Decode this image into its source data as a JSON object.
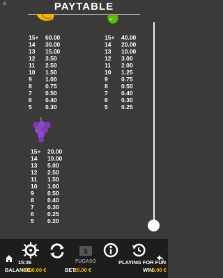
{
  "header": {
    "title": "PAYTABLE",
    "top_marker": "8"
  },
  "sections": {
    "left_top": {
      "symbol": "banana",
      "rows": [
        {
          "n": "15+",
          "v": "60.00"
        },
        {
          "n": "14",
          "v": "30.00"
        },
        {
          "n": "13",
          "v": "15.00"
        },
        {
          "n": "12",
          "v": "3.50"
        },
        {
          "n": "11",
          "v": "2.50"
        },
        {
          "n": "10",
          "v": "1.50"
        },
        {
          "n": "9",
          "v": "1.00"
        },
        {
          "n": "8",
          "v": "0.75"
        },
        {
          "n": "7",
          "v": "0.50"
        },
        {
          "n": "6",
          "v": "0.40"
        },
        {
          "n": "5",
          "v": "0.30"
        }
      ]
    },
    "right_top": {
      "symbol": "apple",
      "rows": [
        {
          "n": "15+",
          "v": "40.00"
        },
        {
          "n": "14",
          "v": "20.00"
        },
        {
          "n": "13",
          "v": "10.00"
        },
        {
          "n": "12",
          "v": "3.00"
        },
        {
          "n": "11",
          "v": "2.00"
        },
        {
          "n": "10",
          "v": "1.25"
        },
        {
          "n": "9",
          "v": "0.75"
        },
        {
          "n": "8",
          "v": "0.50"
        },
        {
          "n": "7",
          "v": "0.40"
        },
        {
          "n": "6",
          "v": "0.30"
        },
        {
          "n": "5",
          "v": "0.25"
        }
      ]
    },
    "left_bottom": {
      "symbol": "grapes",
      "rows": [
        {
          "n": "15+",
          "v": "20.00"
        },
        {
          "n": "14",
          "v": "10.00"
        },
        {
          "n": "13",
          "v": "5.00"
        },
        {
          "n": "12",
          "v": "2.50"
        },
        {
          "n": "11",
          "v": "1.50"
        },
        {
          "n": "10",
          "v": "1.00"
        },
        {
          "n": "9",
          "v": "0.50"
        },
        {
          "n": "8",
          "v": "0.40"
        },
        {
          "n": "7",
          "v": "0.30"
        },
        {
          "n": "6",
          "v": "0.25"
        },
        {
          "n": "5",
          "v": "0.20"
        }
      ]
    }
  },
  "footer": {
    "time": "15:36",
    "brand": "FUGASO",
    "mode": "PLAYING FOR FUN",
    "balance_label": "BALANCE:",
    "balance_value": "3000.00 €",
    "bet_label": "BET:",
    "bet_value": "20.00 €",
    "win_label": "WIN:",
    "win_value": "0.00 €"
  },
  "colors": {
    "accent": "#f2c200",
    "background": "#3b3a39",
    "bar": "#1e1d1c"
  }
}
